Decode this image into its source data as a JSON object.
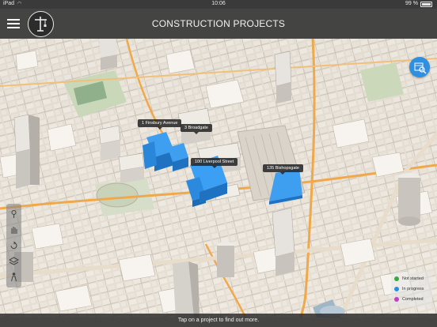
{
  "status_bar": {
    "carrier": "iPad",
    "time": "10:06",
    "battery": "99 %"
  },
  "header": {
    "title": "CONSTRUCTION PROJECTS"
  },
  "projects": [
    {
      "name": "1 Finsbury Avenue",
      "status": "in-progress"
    },
    {
      "name": "3 Broadgate",
      "status": "in-progress"
    },
    {
      "name": "100 Liverpool Street",
      "status": "in-progress"
    },
    {
      "name": "135 Bishopsgate",
      "status": "in-progress"
    }
  ],
  "legend": {
    "items": [
      {
        "label": "Not started",
        "color": "#3ca83c"
      },
      {
        "label": "In progress",
        "color": "#2a8de0"
      },
      {
        "label": "Completed",
        "color": "#c43fc4"
      }
    ]
  },
  "hint": "Tap on a project to find out more.",
  "colors": {
    "project_blue": "#2a8de0",
    "header_bg": "#373737",
    "accent": "#2f8fe0"
  },
  "icons": {
    "menu": "hamburger-icon",
    "logo": "crane-logo-icon",
    "search": "map-search-icon",
    "tools": [
      "pin-tool-icon",
      "hand-tool-icon",
      "rotate-tool-icon",
      "layers-tool-icon",
      "person-tool-icon"
    ]
  }
}
